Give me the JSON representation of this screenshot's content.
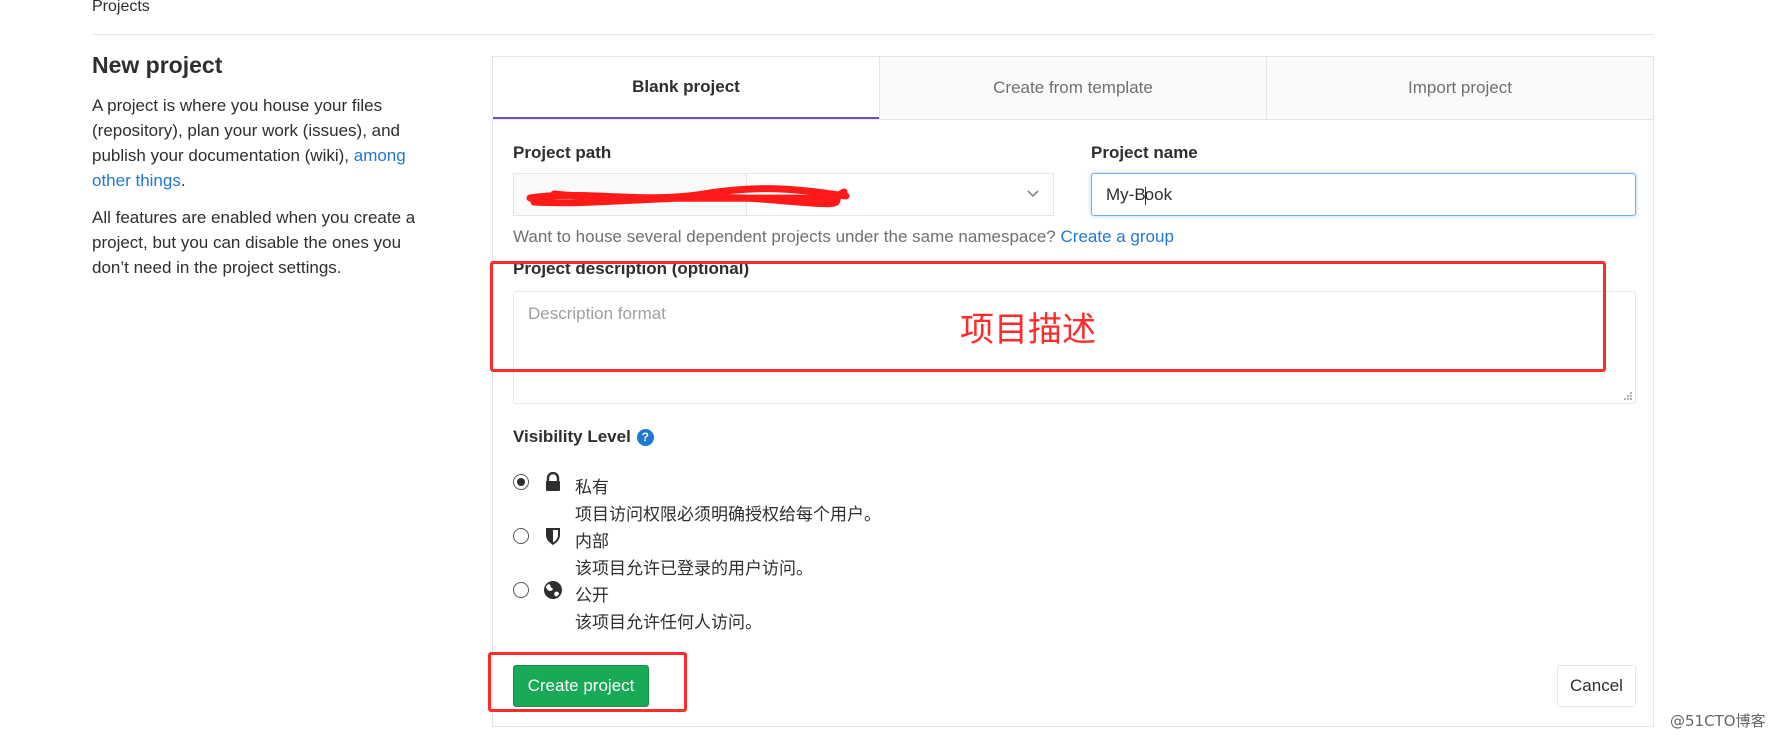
{
  "breadcrumb": "Projects",
  "intro": {
    "title": "New project",
    "para1": "A project is where you house your files (repository), plan your work (issues), and publish your documentation (wiki), ",
    "para1_link": "among other things",
    "para1_end": ".",
    "para2": "All features are enabled when you create a project, but you can disable the ones you don’t need in the project settings."
  },
  "tabs": [
    {
      "label": "Blank project",
      "active": true
    },
    {
      "label": "Create from template",
      "active": false
    },
    {
      "label": "Import project",
      "active": false
    }
  ],
  "form": {
    "path_label": "Project path",
    "name_label": "Project name",
    "name_value_before_caret": "My-B",
    "name_value_after_caret": "ook",
    "help_text": "Want to house several dependent projects under the same namespace? ",
    "help_link": "Create a group",
    "desc_label": "Project description (optional)",
    "desc_placeholder": "Description format",
    "desc_annotation": "项目描述",
    "visibility_label": "Visibility Level",
    "visibility_help_icon": "question-circle-icon",
    "visibility_options": [
      {
        "title": "私有",
        "desc": "项目访问权限必须明确授权给每个用户。",
        "icon": "lock-icon",
        "selected": true
      },
      {
        "title": "内部",
        "desc": "该项目允许已登录的用户访问。",
        "icon": "shield-icon",
        "selected": false
      },
      {
        "title": "公开",
        "desc": "该项目允许任何人访问。",
        "icon": "globe-icon",
        "selected": false
      }
    ]
  },
  "buttons": {
    "create": "Create project",
    "cancel": "Cancel"
  },
  "watermark": "@51CTO博客",
  "colors": {
    "accent_tab": "#6b4fbb",
    "link": "#1f78d1",
    "create_button": "#1aaa55",
    "annotation_red": "#ff2a2a"
  }
}
